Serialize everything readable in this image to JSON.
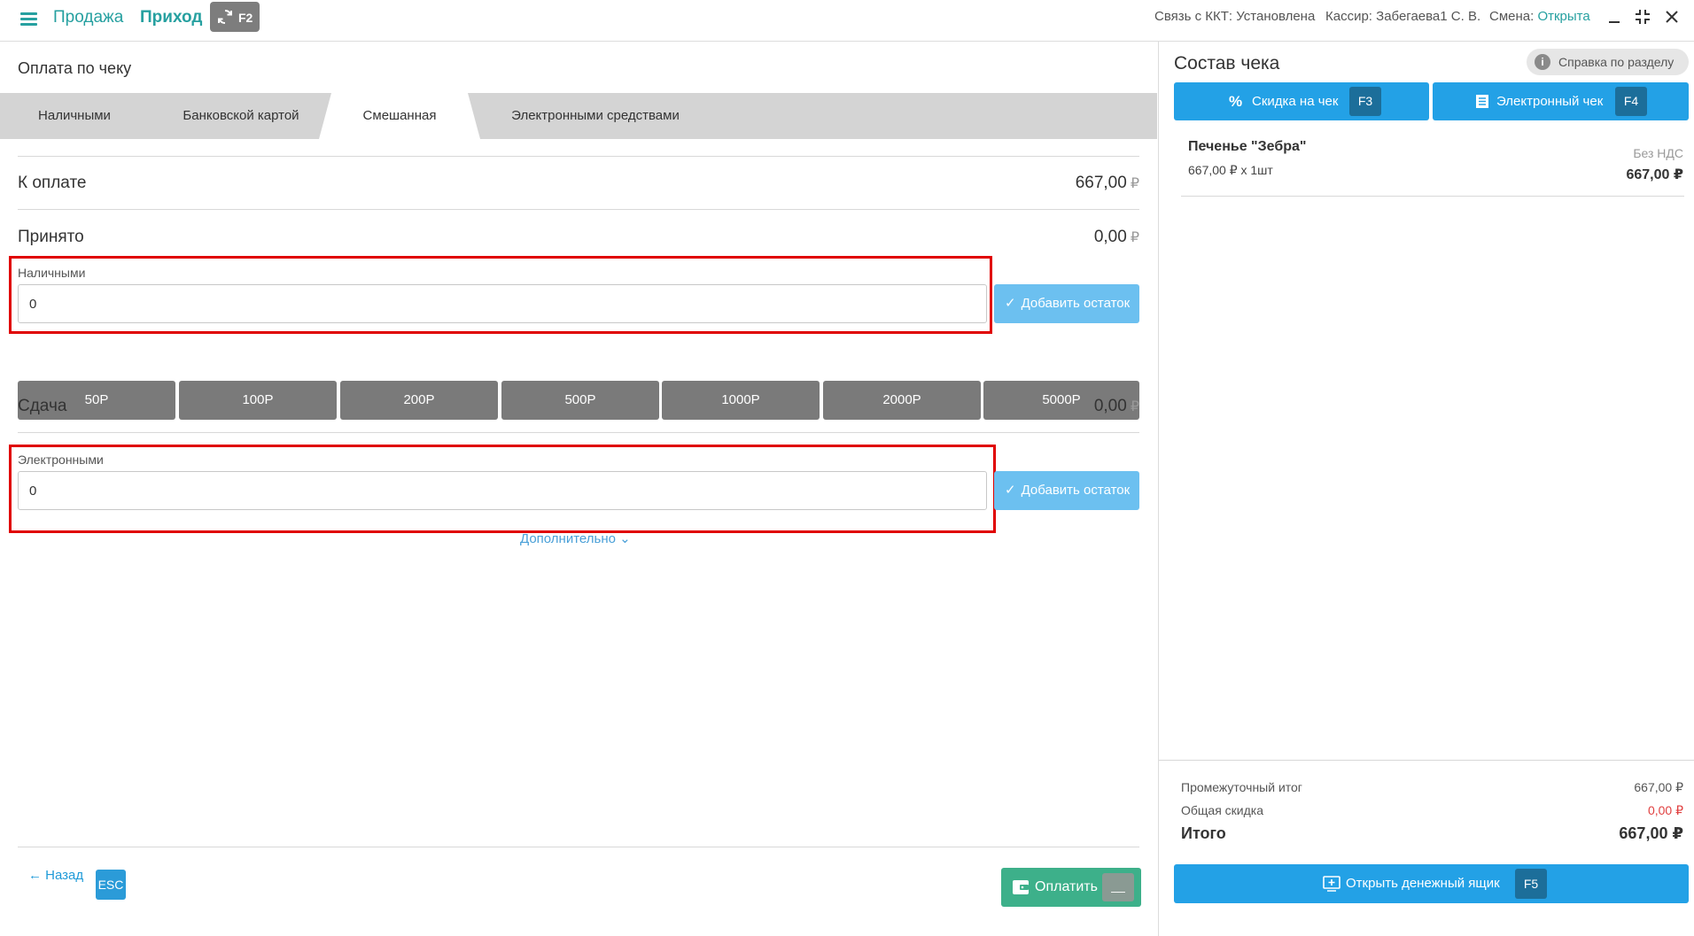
{
  "topbar": {
    "mode_sale": "Продажа",
    "mode_income": "Приход",
    "sync_key": "F2",
    "kkt_label": "Связь с ККТ: ",
    "kkt_value": "Установлена",
    "cashier": "Кассир: Забегаева1 С. В.",
    "shift_label": "Смена: ",
    "shift_value": "Открыта"
  },
  "payment": {
    "title": "Оплата по чеку",
    "tabs": [
      {
        "label": "Наличными"
      },
      {
        "label": "Банковской картой"
      },
      {
        "label": "Смешанная",
        "active": true
      },
      {
        "label": "Электронными средствами"
      }
    ],
    "to_pay_label": "К оплате",
    "to_pay_value": "667,00",
    "accepted_label": "Принято",
    "accepted_value": "0,00",
    "currency": "₽",
    "cash": {
      "label": "Наличными",
      "value": "0"
    },
    "add_rest_label": "Добавить остаток",
    "bills": [
      "50Р",
      "100Р",
      "200Р",
      "500Р",
      "1000Р",
      "2000Р",
      "5000Р"
    ],
    "change_label": "Сдача",
    "change_value": "0,00",
    "electronic": {
      "label": "Электронными",
      "value": "0"
    },
    "extra_label": "Дополнительно",
    "back_label": "Назад",
    "back_key": "ESC",
    "pay_label": "Оплатить",
    "pay_key": "__"
  },
  "receipt": {
    "title": "Состав чека",
    "help_label": "Справка по разделу",
    "discount_btn": {
      "label": "Скидка на чек",
      "key": "F3"
    },
    "echeck_btn": {
      "label": "Электронный чек",
      "key": "F4"
    },
    "item": {
      "name": "Печенье \"Зебра\"",
      "qty": "667,00 ₽ x 1шт",
      "vat": "Без НДС",
      "sum": "667,00 ₽"
    },
    "subtotal_label": "Промежуточный итог",
    "subtotal_value": "667,00 ₽",
    "discount_label": "Общая скидка",
    "discount_value": "0,00 ₽",
    "total_label": "Итого",
    "total_value": "667,00 ₽",
    "drawer_btn": {
      "label": "Открыть денежный ящик",
      "key": "F5"
    }
  },
  "colors": {
    "accent": "#26a0a0",
    "primary": "#23a1e6",
    "pay": "#3db08a",
    "highlight": "#e00000",
    "discount": "#e04040"
  }
}
